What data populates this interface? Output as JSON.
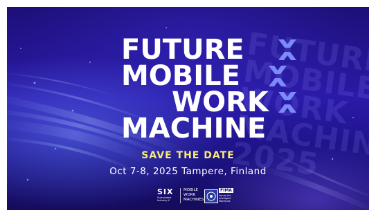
{
  "banner": {
    "title_lines": [
      "FUTURE",
      "MOBILE",
      "WORK",
      "MACHINE"
    ],
    "ghost_text": "FUTURE\nMOBILE\nWORK\nMACHINE\n2025",
    "save_the_date": "SAVE THE DATE",
    "date_location": "Oct 7-8, 2025  Tampere, Finland",
    "accent_color": "#f4e97a",
    "x_mark_color": "#7f8fff",
    "icons": [
      "x-mark-icon",
      "x-mark-icon",
      "x-mark-icon"
    ]
  },
  "logos": {
    "six": {
      "word": "SIX",
      "subtitle": "Sustainable Industry X",
      "tagline": "MOBILE\nWORK\nMACHINES"
    },
    "fima": {
      "word": "FIMA",
      "subtitle": "Forum for Intelligent Machines"
    }
  }
}
